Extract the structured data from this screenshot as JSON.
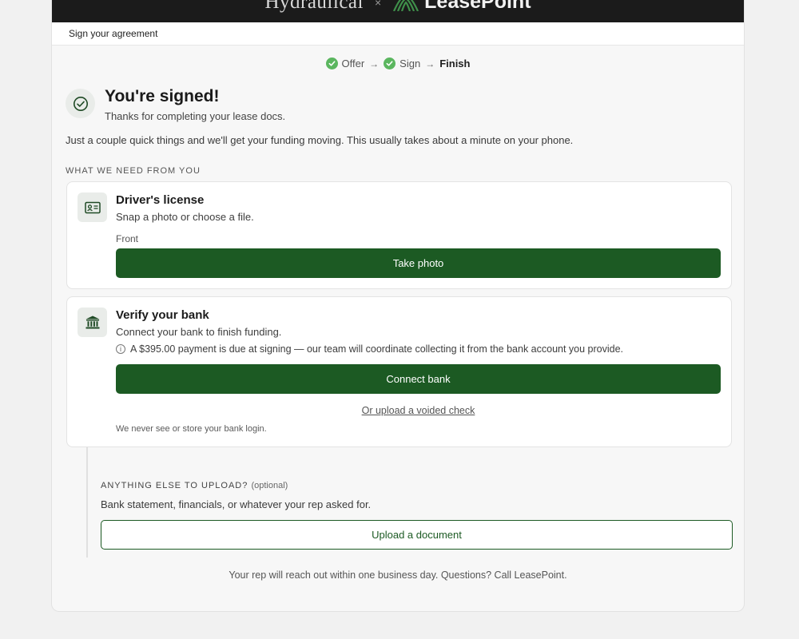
{
  "brand": {
    "partner_name": "Hydraulical",
    "separator": "×",
    "lessor_name": "LeasePoint"
  },
  "header": {
    "title": "Sign your agreement"
  },
  "stepper": {
    "steps": [
      {
        "label": "Offer",
        "state": "done"
      },
      {
        "label": "Sign",
        "state": "done"
      },
      {
        "label": "Finish",
        "state": "current"
      }
    ],
    "arrow": "→"
  },
  "hero": {
    "title": "You're signed!",
    "subtitle": "Thanks for completing your lease docs."
  },
  "intro": "Just a couple quick things and we'll get your funding moving. This usually takes about a minute on your phone.",
  "section_label": "WHAT WE NEED FROM YOU",
  "license_card": {
    "icon": "id-card-icon",
    "title": "Driver's license",
    "description": "Snap a photo or choose a file.",
    "field_label": "Front",
    "button_label": "Take photo"
  },
  "bank_card": {
    "icon": "bank-icon",
    "title": "Verify your bank",
    "description": "Connect your bank to finish funding.",
    "notice": "A $395.00 payment is due at signing — our team will coordinate collecting it from the bank account you provide.",
    "button_label": "Connect bank",
    "alt_link": "Or upload a voided check",
    "fine_print": "We never see or store your bank login."
  },
  "optional_upload": {
    "title": "ANYTHING ELSE TO UPLOAD?",
    "optional_tag": "(optional)",
    "description": "Bank statement, financials, or whatever your rep asked for.",
    "button_label": "Upload a document"
  },
  "footer": "Your rep will reach out within one business day. Questions? Call LeasePoint.",
  "colors": {
    "primary": "#1c5a23",
    "success": "#5bb65f",
    "topbar": "#1b1b1b"
  }
}
